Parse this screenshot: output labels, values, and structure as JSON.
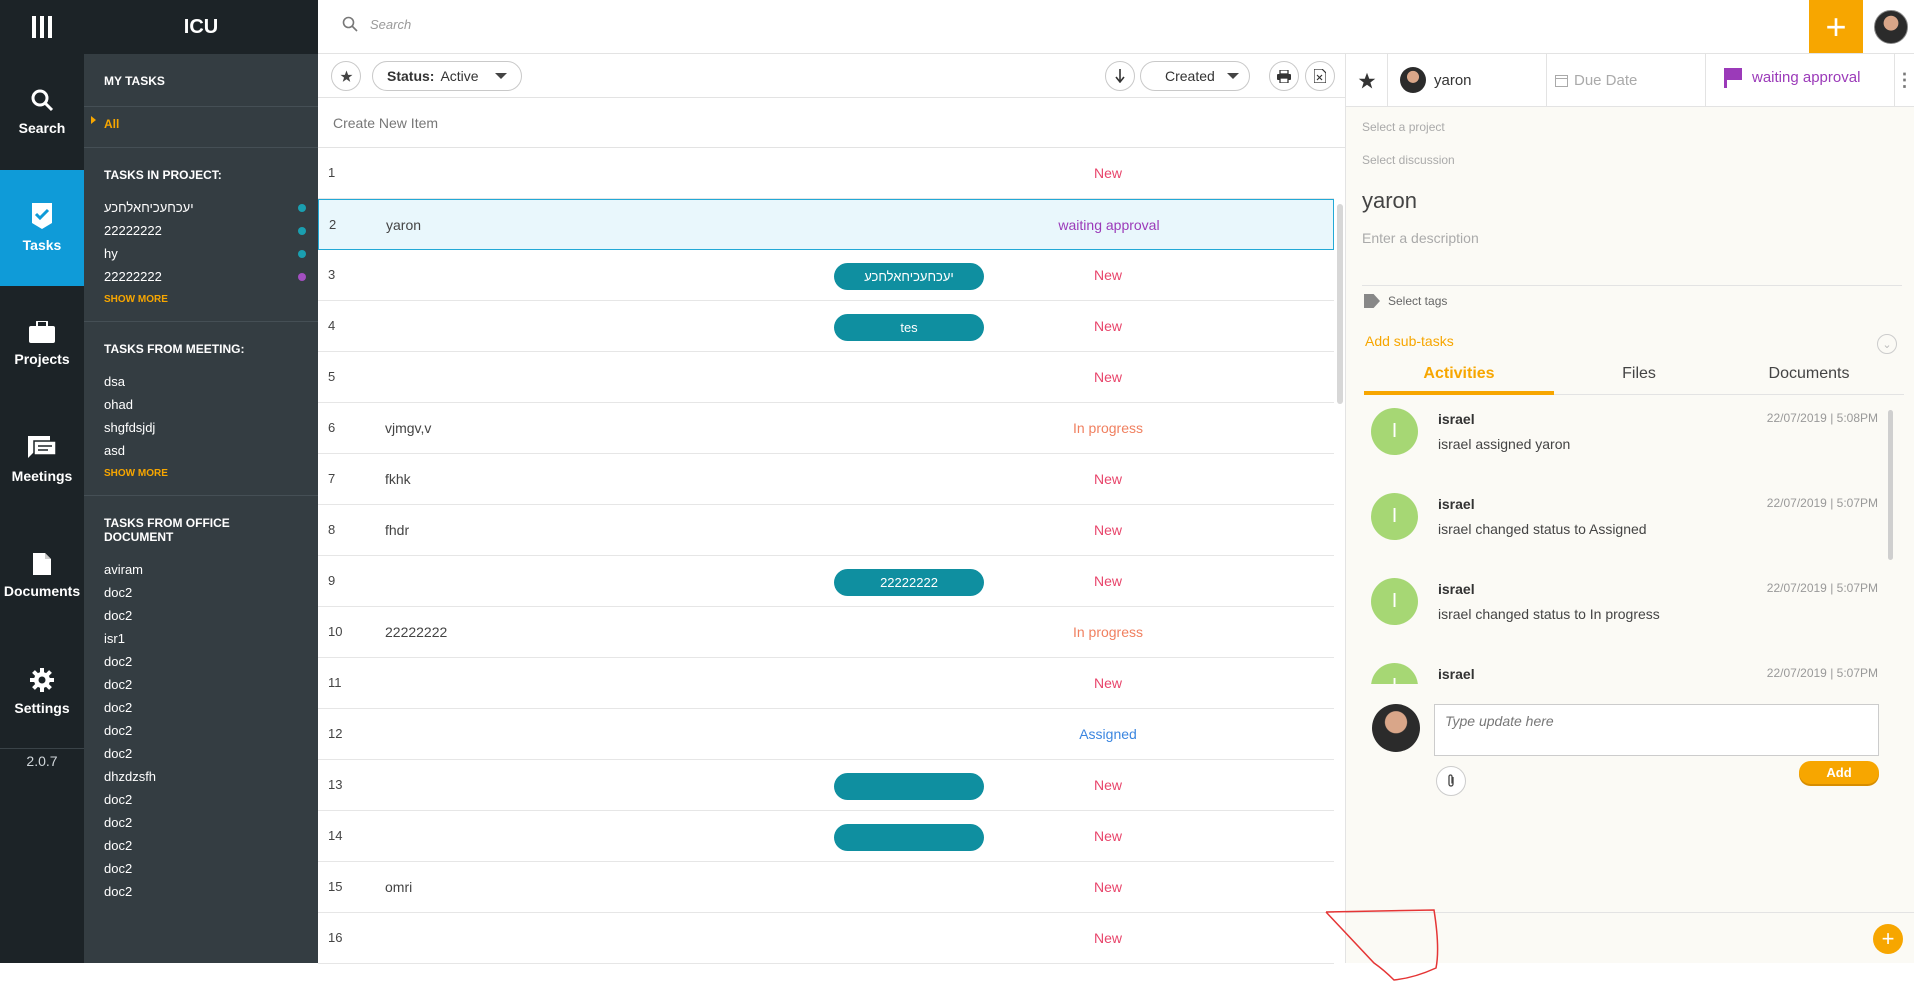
{
  "app": {
    "title": "ICU",
    "version": "2.0.7"
  },
  "rail": [
    {
      "label": "Search",
      "icon": "search-icon"
    },
    {
      "label": "Tasks",
      "icon": "check-icon",
      "active": true
    },
    {
      "label": "Projects",
      "icon": "briefcase-icon"
    },
    {
      "label": "Meetings",
      "icon": "chat-icon"
    },
    {
      "label": "Documents",
      "icon": "document-icon"
    },
    {
      "label": "Settings",
      "icon": "gear-icon"
    }
  ],
  "sidebar": {
    "my_tasks": "MY TASKS",
    "all_label": "All",
    "in_project_heading": "TASKS IN PROJECT:",
    "projects": [
      {
        "name": "יעכחעכיחאלחכע",
        "color": "#1a9fb0"
      },
      {
        "name": "22222222",
        "color": "#1a9fb0"
      },
      {
        "name": "hy",
        "color": "#1a9fb0"
      },
      {
        "name": "22222222",
        "color": "#a34fc1"
      }
    ],
    "show_more": "SHOW MORE",
    "from_meeting_heading": "TASKS FROM MEETING:",
    "meetings": [
      "dsa",
      "ohad",
      "shgfdsjdj",
      "asd"
    ],
    "from_office_heading": "TASKS FROM OFFICE DOCUMENT",
    "documents": [
      "aviram",
      "doc2",
      "doc2",
      "isr1",
      "doc2",
      "doc2",
      "doc2",
      "doc2",
      "doc2",
      "dhzdzsfh",
      "doc2",
      "doc2",
      "doc2",
      "doc2",
      "doc2"
    ]
  },
  "search": {
    "placeholder": "Search"
  },
  "toolbar": {
    "status_label": "Status:",
    "status_value": "Active",
    "sort_value": "Created"
  },
  "list": {
    "create_placeholder": "Create New Item",
    "rows": [
      {
        "num": "1",
        "title": "",
        "tag": "",
        "status": "New",
        "color": "#e8456b"
      },
      {
        "num": "2",
        "title": "yaron",
        "tag": "",
        "status": "waiting approval",
        "color": "#9b3ab9",
        "selected": true
      },
      {
        "num": "3",
        "title": "",
        "tag": "יעכחעכיחאלחכע",
        "status": "New",
        "color": "#e8456b"
      },
      {
        "num": "4",
        "title": "",
        "tag": "tes",
        "status": "New",
        "color": "#e8456b"
      },
      {
        "num": "5",
        "title": "",
        "tag": "",
        "status": "New",
        "color": "#e8456b"
      },
      {
        "num": "6",
        "title": "vjmgv,v",
        "tag": "",
        "status": "In progress",
        "color": "#f08060"
      },
      {
        "num": "7",
        "title": "fkhk",
        "tag": "",
        "status": "New",
        "color": "#e8456b"
      },
      {
        "num": "8",
        "title": "fhdr",
        "tag": "",
        "status": "New",
        "color": "#e8456b"
      },
      {
        "num": "9",
        "title": "",
        "tag": "22222222",
        "status": "New",
        "color": "#e8456b"
      },
      {
        "num": "10",
        "title": "22222222",
        "tag": "",
        "status": "In progress",
        "color": "#f08060"
      },
      {
        "num": "11",
        "title": "",
        "tag": "",
        "status": "New",
        "color": "#e8456b"
      },
      {
        "num": "12",
        "title": "",
        "tag": "",
        "status": "Assigned",
        "color": "#3b86e0"
      },
      {
        "num": "13",
        "title": "",
        "tag": " ",
        "status": "New",
        "color": "#e8456b"
      },
      {
        "num": "14",
        "title": "",
        "tag": " ",
        "status": "New",
        "color": "#e8456b"
      },
      {
        "num": "15",
        "title": "omri",
        "tag": "",
        "status": "New",
        "color": "#e8456b"
      },
      {
        "num": "16",
        "title": "",
        "tag": "",
        "status": "New",
        "color": "#e8456b"
      }
    ]
  },
  "detail": {
    "assignee": "yaron",
    "due_date": "Due Date",
    "status": "waiting approval",
    "select_project": "Select a project",
    "select_discussion": "Select discussion",
    "name": "yaron",
    "description_placeholder": "Enter a description",
    "select_tags": "Select tags",
    "add_subtasks": "Add sub-tasks",
    "tabs": [
      "Activities",
      "Files",
      "Documents"
    ],
    "activities": [
      {
        "initial": "I",
        "user": "israel",
        "time": "22/07/2019 | 5:08PM",
        "text": "israel assigned yaron"
      },
      {
        "initial": "I",
        "user": "israel",
        "time": "22/07/2019 | 5:07PM",
        "text": "israel changed status to Assigned"
      },
      {
        "initial": "I",
        "user": "israel",
        "time": "22/07/2019 | 5:07PM",
        "text": "israel changed status to In progress"
      },
      {
        "initial": "I",
        "user": "israel",
        "time": "22/07/2019 | 5:07PM",
        "text": ""
      }
    ],
    "composer_placeholder": "Type update here",
    "add_label": "Add"
  }
}
